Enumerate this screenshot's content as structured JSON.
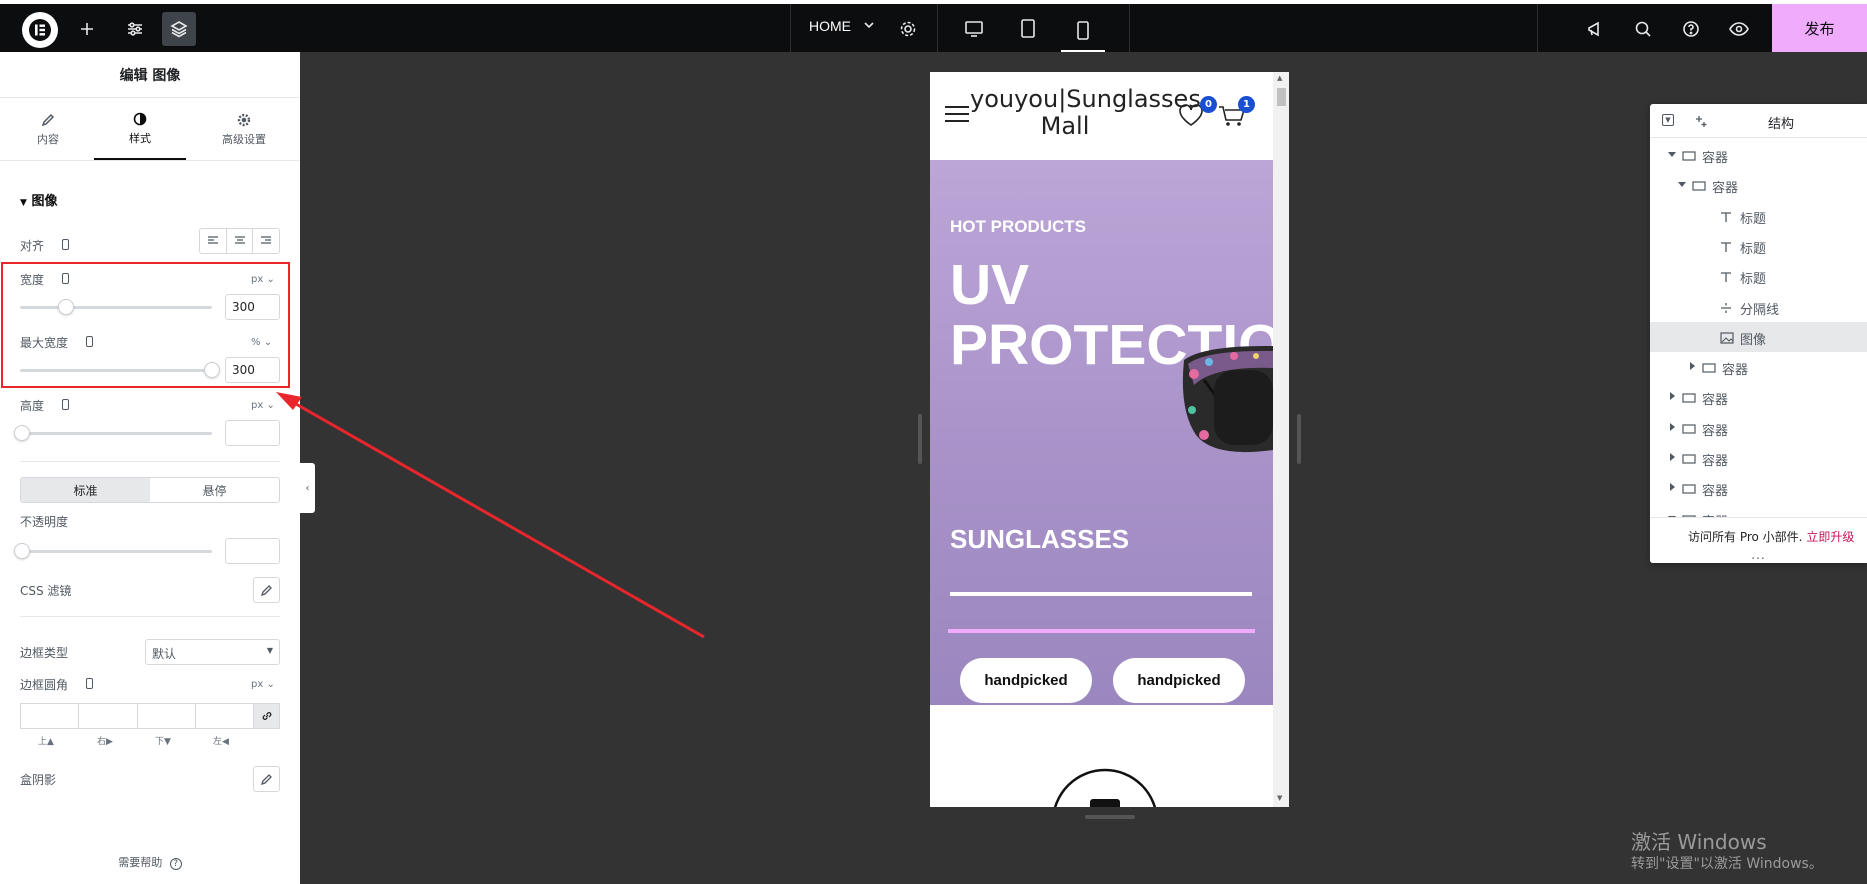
{
  "topbar": {
    "page_name": "HOME",
    "publish_label": "发布"
  },
  "panel": {
    "title": "编辑 图像",
    "tabs": [
      {
        "label": "内容",
        "icon": "pencil-icon"
      },
      {
        "label": "样式",
        "icon": "contrast-icon"
      },
      {
        "label": "高级设置",
        "icon": "gear-icon"
      }
    ],
    "section_title": "图像",
    "align_label": "对齐",
    "width_label": "宽度",
    "width_unit": "px",
    "width_value": "300",
    "width_level": 0.24,
    "max_width_label": "最大宽度",
    "max_width_unit": "%",
    "max_width_value": "300",
    "max_width_level": 1.0,
    "height_label": "高度",
    "height_unit": "px",
    "toggle_normal": "标准",
    "toggle_hover": "悬停",
    "opacity_label": "不透明度",
    "css_filter_label": "CSS 滤镜",
    "border_type_label": "边框类型",
    "border_type_value": "默认",
    "border_radius_label": "边框圆角",
    "border_radius_unit": "px",
    "radius_top": "上▲",
    "radius_right": "右▶",
    "radius_bottom": "下▼",
    "radius_left": "左◀",
    "box_shadow_label": "盒阴影",
    "help_label": "需要帮助"
  },
  "preview": {
    "site_title": "youyou|Sunglasses Mall",
    "wishlist_count": "0",
    "cart_count": "1",
    "hero_subtitle": "HOT PRODUCTS",
    "hero_title": "UV PROTECTION",
    "hero_sub2": "SUNGLASSES",
    "button1": "handpicked",
    "button2": "handpicked"
  },
  "navigator": {
    "title": "结构",
    "items": [
      {
        "label": "容器",
        "level": 0,
        "expand": "down",
        "icon": "container-icon"
      },
      {
        "label": "容器",
        "level": 1,
        "expand": "down",
        "icon": "container-icon"
      },
      {
        "label": "标题",
        "level": 2,
        "expand": "none",
        "icon": "heading-icon"
      },
      {
        "label": "标题",
        "level": 2,
        "expand": "none",
        "icon": "heading-icon"
      },
      {
        "label": "标题",
        "level": 2,
        "expand": "none",
        "icon": "heading-icon"
      },
      {
        "label": "分隔线",
        "level": 2,
        "expand": "none",
        "icon": "divider-icon"
      },
      {
        "label": "图像",
        "level": 2,
        "expand": "none",
        "icon": "image-icon",
        "selected": true
      },
      {
        "label": "容器",
        "level": 2,
        "expand": "right",
        "icon": "container-icon"
      },
      {
        "label": "容器",
        "level": 0,
        "expand": "right",
        "icon": "container-icon"
      },
      {
        "label": "容器",
        "level": 0,
        "expand": "right",
        "icon": "container-icon"
      },
      {
        "label": "容器",
        "level": 0,
        "expand": "right",
        "icon": "container-icon"
      },
      {
        "label": "容器",
        "level": 0,
        "expand": "right",
        "icon": "container-icon"
      },
      {
        "label": "容器",
        "level": 0,
        "expand": "down",
        "icon": "container-icon"
      }
    ],
    "pro_text": "访问所有 Pro 小部件.",
    "pro_link": "立即升级",
    "dots": "..."
  },
  "watermark": {
    "line1": "激活 Windows",
    "line2": "转到\"设置\"以激活 Windows。"
  },
  "colors": {
    "accent_pink": "#f0abfc",
    "highlight_red": "#e8262c",
    "badge_blue": "#1b4fd1",
    "hero_purple": "#a993c9"
  }
}
